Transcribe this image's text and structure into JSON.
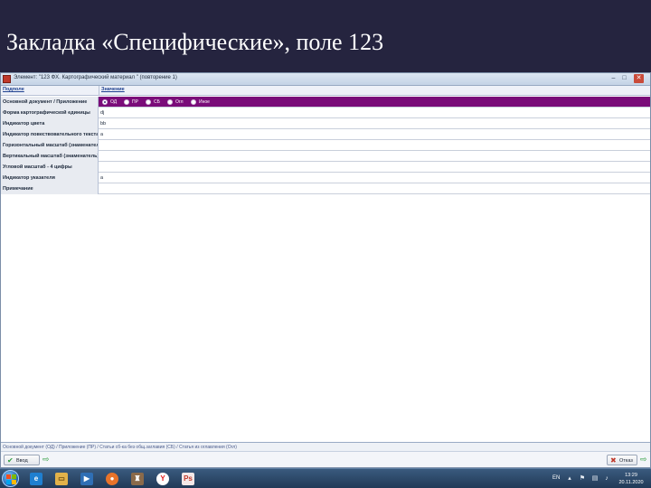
{
  "slide": {
    "title": "Закладка «Специфические», поле 123"
  },
  "window": {
    "title": "Элемент: \"123 ФХ. Картографический материал \" (повторение 1)",
    "controls": {
      "minimize": "–",
      "maximize": "□",
      "close": "✕"
    }
  },
  "grid": {
    "columns": [
      "Подполе",
      "Значение"
    ],
    "rows": [
      {
        "label": "Основной документ / Приложение",
        "value": "",
        "selected": true
      },
      {
        "label": "Форма картографической единицы",
        "value": "dj"
      },
      {
        "label": "Индикатор цвета",
        "value": "bb"
      },
      {
        "label": "Индикатор повествовательного текста",
        "value": "a"
      },
      {
        "label": "Горизонтальный масштаб (знаменатель)",
        "value": ""
      },
      {
        "label": "Вертикальный масштаб (знаменатель)",
        "value": ""
      },
      {
        "label": "Угловой масштаб - 4 цифры",
        "value": ""
      },
      {
        "label": "Индикатор указателя",
        "value": "a"
      },
      {
        "label": "Примечание",
        "value": ""
      }
    ],
    "radio_options": [
      {
        "label": "ОД",
        "checked": true
      },
      {
        "label": "ПР",
        "checked": false
      },
      {
        "label": "СБ",
        "checked": false
      },
      {
        "label": "Огл",
        "checked": false
      },
      {
        "label": "Иное",
        "checked": false
      }
    ]
  },
  "status": {
    "text": "Основной документ (ОД) / Приложение (ПР) / Статьи сб-ка без общ.заглавия (СБ) / Статья из оглавления (Огл)"
  },
  "buttons": {
    "ok": "Ввод",
    "cancel": "Отказ"
  },
  "taskbar": {
    "language": "EN",
    "time": "13:29",
    "date": "20.11.2020",
    "apps": [
      "ie-icon",
      "explorer-icon",
      "media-player-icon",
      "firefox-icon",
      "game-icon",
      "yandex-icon",
      "photoshop-icon"
    ]
  },
  "colors": {
    "selected_row": "#7a0c79",
    "slide_bg": "#24233f",
    "taskbar": "#2a4667"
  }
}
